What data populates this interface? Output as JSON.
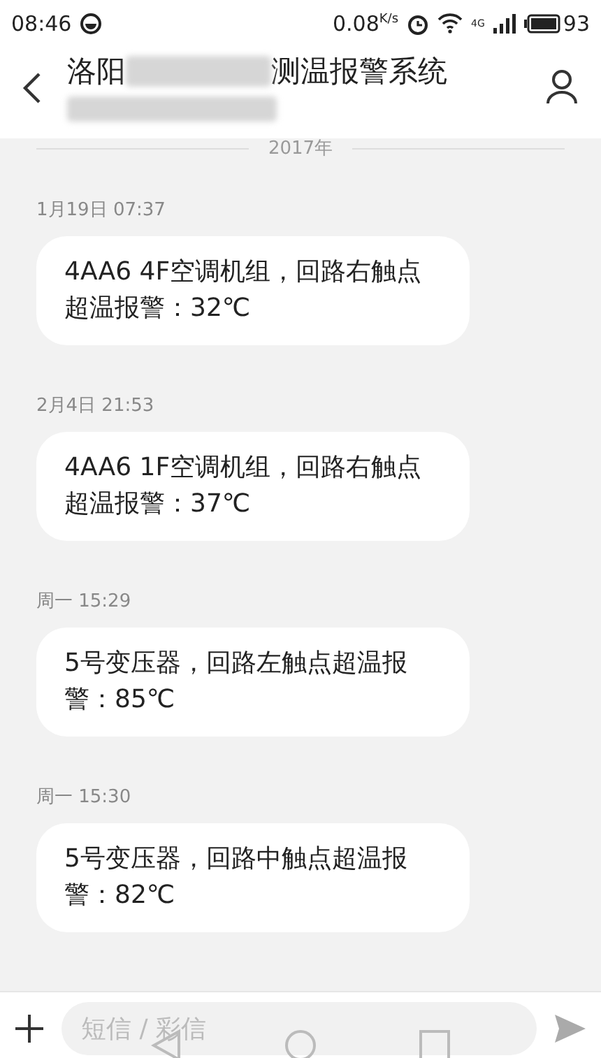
{
  "status_bar": {
    "time": "08:46",
    "speed": "0.08",
    "speed_unit": "K/s",
    "network": "4G",
    "battery": "93"
  },
  "header": {
    "title_start": "洛阳",
    "title_end": "测温报警系统"
  },
  "year_divider": "2017年",
  "messages": [
    {
      "time": "1月19日 07:37",
      "text": "4AA6  4F空调机组，回路右触点超温报警：32℃"
    },
    {
      "time": "2月4日 21:53",
      "text": "4AA6  1F空调机组，回路右触点超温报警：37℃"
    },
    {
      "time": "周一 15:29",
      "text": "5号变压器，回路左触点超温报警：85℃"
    },
    {
      "time": "周一 15:30",
      "text": "5号变压器，回路中触点超温报警：82℃"
    }
  ],
  "composer": {
    "placeholder": "短信 / 彩信"
  }
}
